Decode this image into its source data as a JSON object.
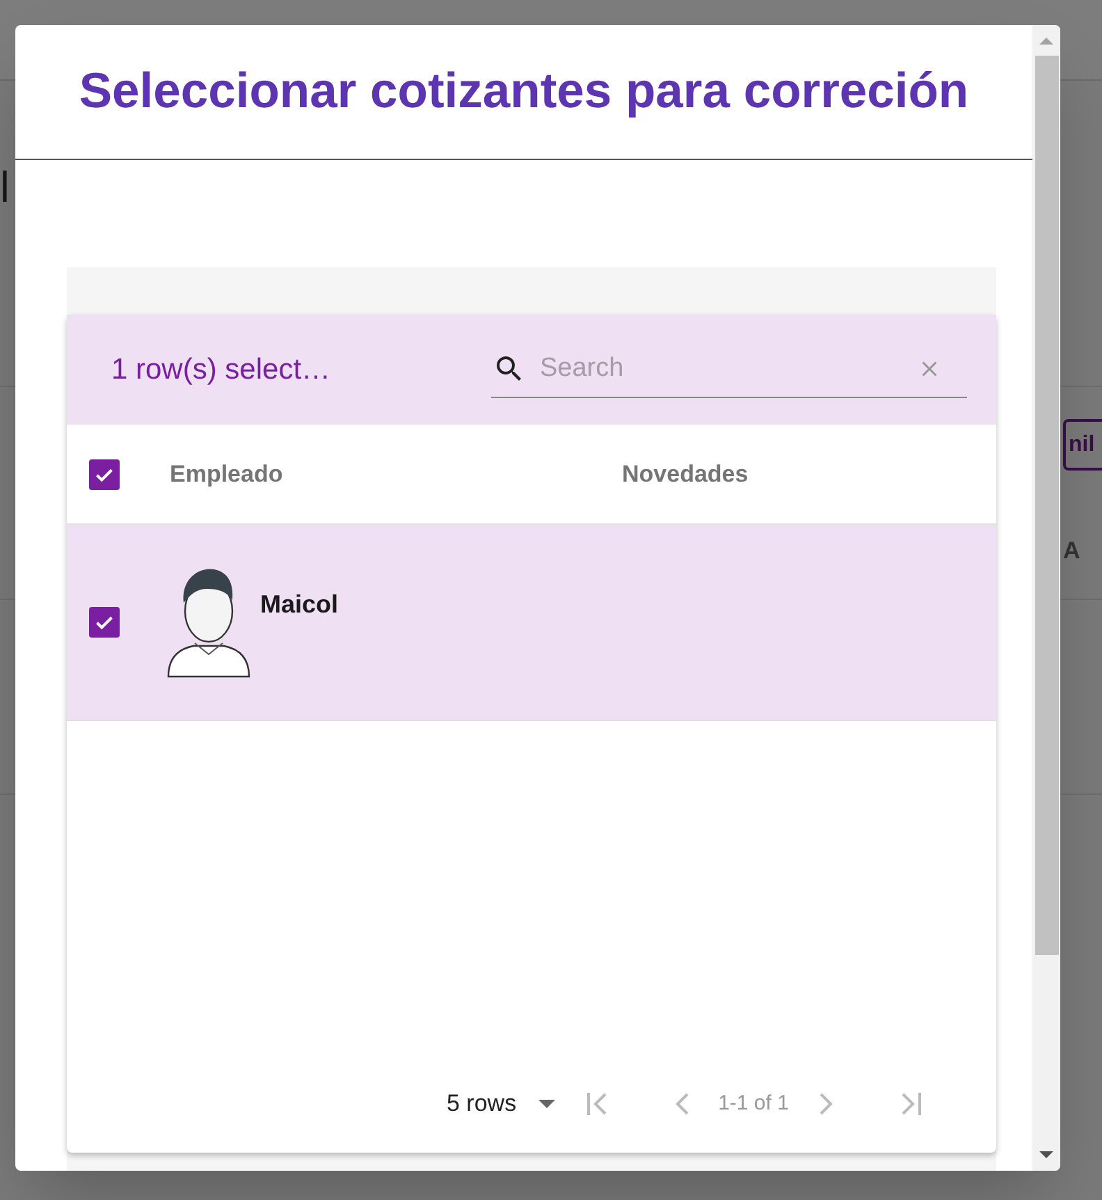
{
  "background": {
    "fragments": [
      {
        "kind": "heading",
        "text": "l"
      },
      {
        "kind": "button",
        "text": "nil"
      },
      {
        "kind": "cell",
        "text": "A"
      }
    ]
  },
  "dialog": {
    "title": "Seleccionar cotizantes para correción"
  },
  "table": {
    "toolbar": {
      "selection_text": "1 row(s) select…",
      "search": {
        "placeholder": "Search"
      }
    },
    "select_all": {
      "checked": true
    },
    "columns": [
      "Empleado",
      "Novedades"
    ],
    "rows": [
      {
        "selected": true,
        "name": "Maicol"
      }
    ],
    "pagination": {
      "rows_per_page": "5 rows",
      "range": "1-1 of 1"
    }
  }
}
